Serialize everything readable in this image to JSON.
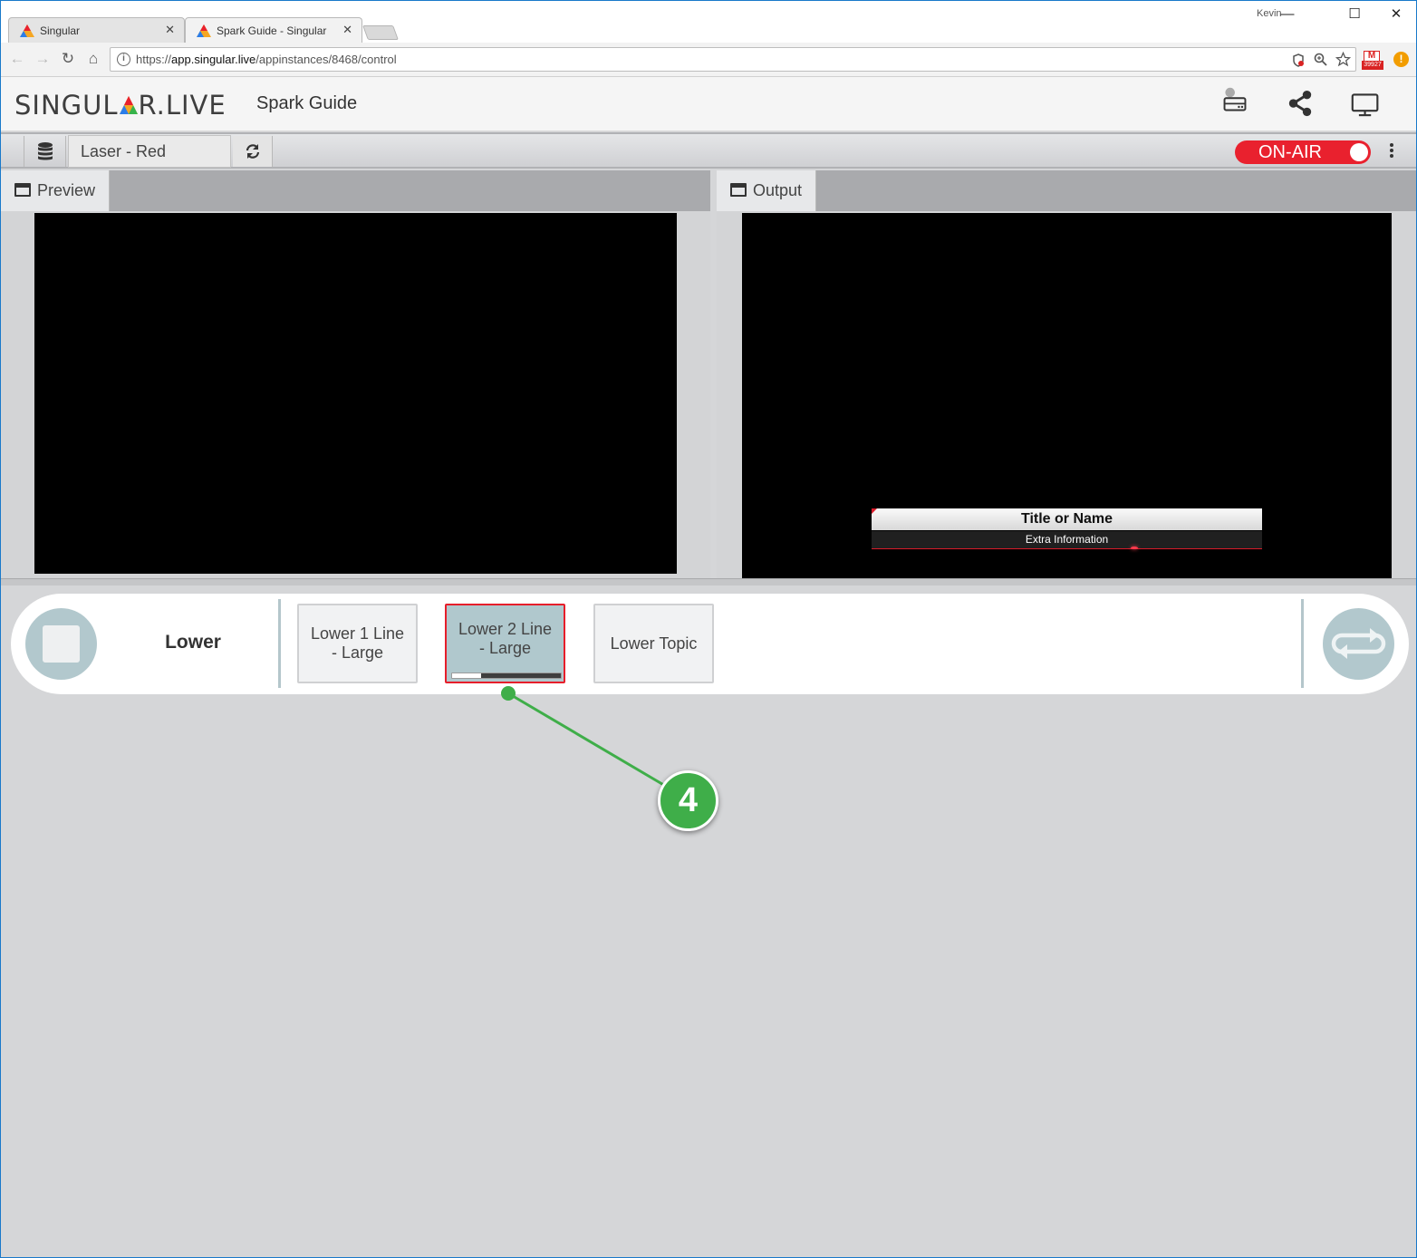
{
  "browser": {
    "tabs": [
      {
        "label": "Singular"
      },
      {
        "label": "Spark Guide - Singular"
      }
    ],
    "profile_name": "Kevin",
    "url_scheme": "https://",
    "url_host": "app.singular.live",
    "url_path": "/appinstances/8468/control",
    "gmail_count": "39927",
    "window_controls": {
      "minimize": "—",
      "maximize": "☐",
      "close": "✕"
    },
    "tab_close_glyph": "✕",
    "nav": {
      "back": "←",
      "forward": "→",
      "reload": "↻",
      "home": "⌂"
    }
  },
  "app": {
    "logo_left": "SINGUL",
    "logo_right": "R.LIVE",
    "title": "Spark Guide",
    "header_icons": [
      "storage-icon",
      "share-icon",
      "monitor-icon"
    ]
  },
  "controlbar": {
    "theme": "Laser - Red",
    "onair_label": "ON-AIR",
    "onair_color": "#e9212e"
  },
  "preview": {
    "label": "Preview"
  },
  "output": {
    "label": "Output",
    "graphic_title": "Title or Name",
    "graphic_subtitle": "Extra Information"
  },
  "control_strip": {
    "name": "Lower",
    "buttons": [
      {
        "label": "Lower 1 Line - Large",
        "active": false
      },
      {
        "label": "Lower 2 Line - Large",
        "active": true,
        "progress": 0.27
      },
      {
        "label": "Lower Topic",
        "active": false
      }
    ]
  },
  "annotation": {
    "number": "4",
    "color": "#3fae49"
  }
}
